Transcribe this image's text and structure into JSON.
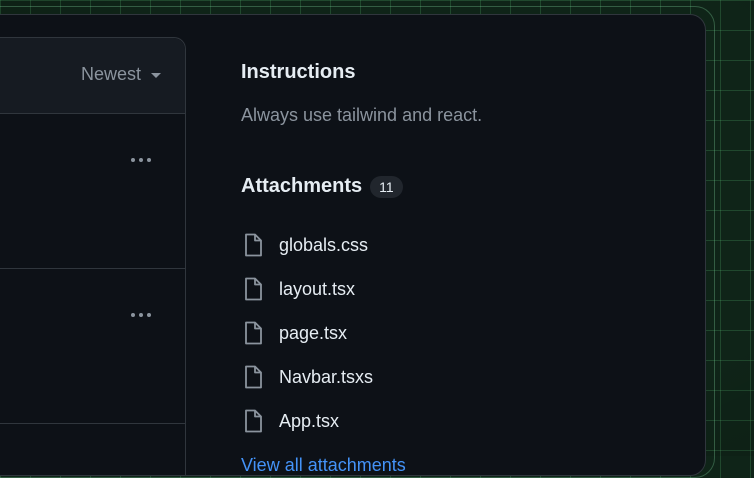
{
  "list": {
    "sort_label": "Newest"
  },
  "instructions": {
    "title": "Instructions",
    "text": "Always use tailwind and react."
  },
  "attachments": {
    "title": "Attachments",
    "count": "11",
    "files": [
      {
        "name": "globals.css",
        "icon": "file-icon"
      },
      {
        "name": "layout.tsx",
        "icon": "file-icon"
      },
      {
        "name": "page.tsx",
        "icon": "file-icon"
      },
      {
        "name": "Navbar.tsxs",
        "icon": "file-icon"
      },
      {
        "name": "App.tsx",
        "icon": "file-icon"
      }
    ],
    "view_all_label": "View all attachments"
  },
  "colors": {
    "background": "#0f2418",
    "panel": "#0d1117",
    "border": "#30363d",
    "muted_text": "#8b949e",
    "link": "#4493f8"
  }
}
